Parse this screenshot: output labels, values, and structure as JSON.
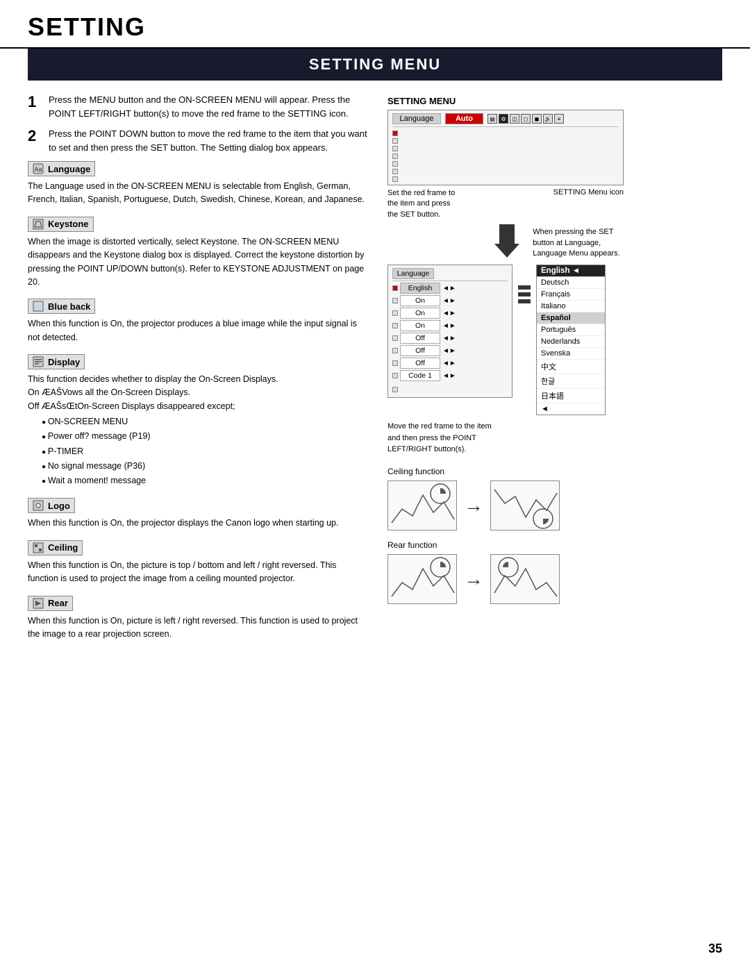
{
  "page": {
    "title": "SETTING",
    "section_title": "SETTING MENU",
    "page_number": "35"
  },
  "steps": [
    {
      "num": "1",
      "text": "Press the MENU button and the ON-SCREEN MENU will appear.  Press the POINT LEFT/RIGHT button(s) to move the red frame to  the SETTING icon."
    },
    {
      "num": "2",
      "text": "Press the POINT DOWN button to move the red frame to the item that you want to set and then press the SET button.  The Setting dialog box appears."
    }
  ],
  "settings": [
    {
      "id": "language",
      "label": "Language",
      "icon": "🌐",
      "desc": "The Language used in the ON-SCREEN MENU is selectable from English, German, French, Italian, Spanish, Portuguese, Dutch, Swedish, Chinese, Korean, and Japanese."
    },
    {
      "id": "keystone",
      "label": "Keystone",
      "icon": "▱",
      "desc": "When the image is distorted vertically, select Keystone.  The ON-SCREEN MENU disappears and the Keystone dialog box is displayed.  Correct the keystone distortion by pressing the POINT UP/DOWN button(s).  Refer to KEYSTONE ADJUSTMENT on page 20."
    },
    {
      "id": "blue_back",
      "label": "Blue back",
      "icon": "□",
      "desc": "When this function is  On,  the projector produces a blue image while the input signal is not detected."
    },
    {
      "id": "display",
      "label": "Display",
      "icon": "▤",
      "desc": "This function decides whether to display the On-Screen Displays.",
      "sub_lines": [
        "On  ÆAŠVows all the On-Screen Displays.",
        "Off ÆAŠsŒtOn-Screen Displays disappeared except;"
      ],
      "bullets": [
        "ON-SCREEN MENU",
        "Power off?  message (P19)",
        "P-TIMER",
        "No signal  message (P36)",
        "Wait a moment!  message"
      ]
    },
    {
      "id": "logo",
      "label": "Logo",
      "icon": "◉",
      "desc": "When this function is  On,  the projector displays the Canon logo when starting up."
    },
    {
      "id": "ceiling",
      "label": "Ceiling",
      "icon": "⊞",
      "desc": "When this function is  On,  the picture is top / bottom and left / right reversed.  This function is used to project the image from a ceiling mounted projector."
    },
    {
      "id": "rear",
      "label": "Rear",
      "icon": "⊟",
      "desc": "When this function is  On,  picture is left / right reversed.  This function is used to project the image to a rear projection screen."
    }
  ],
  "right_panel": {
    "setting_menu_label": "SETTING MENU",
    "menu_diagram": {
      "label_cell": "Language",
      "value_cell": "Auto"
    },
    "annotation_left": "Set the red frame to\nthe item and press\nthe SET button.",
    "annotation_right": "SETTING Menu icon",
    "arrow_desc": "When pressing the SET\nbutton at Language,\nLanguage Menu appears.",
    "lang_diagram_label": "Language",
    "lang_diagram_value": "English",
    "lang_list": [
      {
        "lang": "English",
        "selected": true
      },
      {
        "lang": "Deutsch",
        "selected": false
      },
      {
        "lang": "Français",
        "selected": false
      },
      {
        "lang": "Italiano",
        "selected": false
      },
      {
        "lang": "Español",
        "selected": false
      },
      {
        "lang": "Português",
        "selected": false
      },
      {
        "lang": "Nederlands",
        "selected": false
      },
      {
        "lang": "Svenska",
        "selected": false
      },
      {
        "lang": "中文",
        "selected": false
      },
      {
        "lang": "한글",
        "selected": false
      },
      {
        "lang": "日本語",
        "selected": false
      }
    ],
    "lang_annotation": "Move the red frame to the item\nand then press the POINT\nLEFT/RIGHT button(s).",
    "ceiling_label": "Ceiling function",
    "rear_label": "Rear function"
  }
}
